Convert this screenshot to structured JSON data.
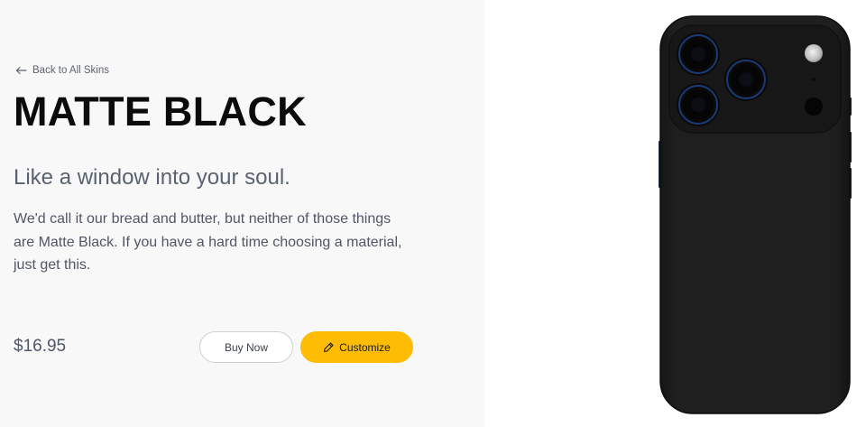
{
  "nav": {
    "back_label": "Back to All Skins"
  },
  "product": {
    "title": "MATTE BLACK",
    "tagline": "Like a window into your soul.",
    "description": "We'd call it our bread and butter, but neither of those things are Matte Black. If you have a hard time choosing a material, just get this.",
    "price": "$16.95"
  },
  "actions": {
    "buy_label": "Buy Now",
    "customize_label": "Customize"
  },
  "colors": {
    "accent": "#ffbc05",
    "skin": "#1e1e1e",
    "left_background": "#f8f8f8"
  },
  "icons": {
    "back": "arrow-left-icon",
    "customize": "pen-icon"
  }
}
